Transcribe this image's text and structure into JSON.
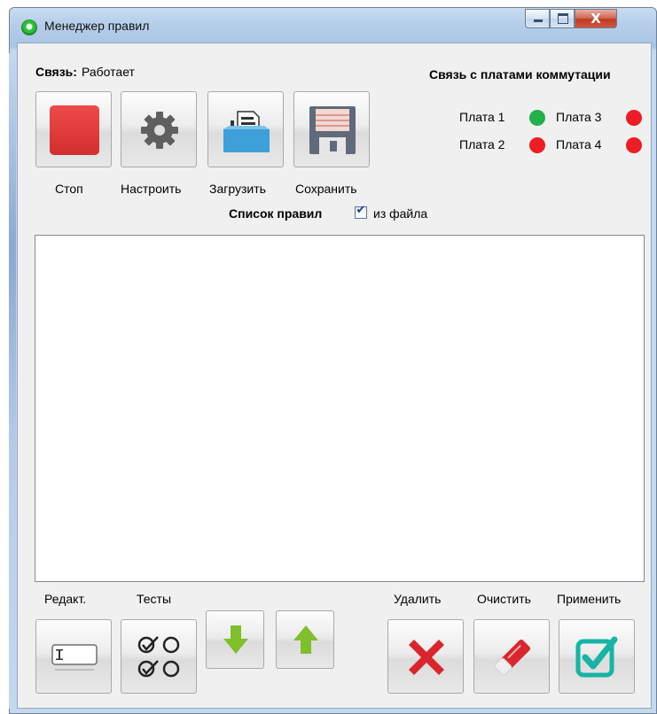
{
  "window": {
    "title": "Менеджер правил",
    "close_glyph": "X",
    "buttons": [
      "minimize-icon",
      "maximize-icon",
      "close-icon"
    ]
  },
  "status": {
    "label": "Связь:",
    "value": "Работает"
  },
  "boards": {
    "title": "Связь с платами коммутации",
    "items": [
      {
        "label": "Плата 1",
        "status": "ok",
        "color": "#22b04a"
      },
      {
        "label": "Плата 3",
        "status": "error",
        "color": "#ee1c24"
      },
      {
        "label": "Плата 2",
        "status": "error",
        "color": "#ee1c24"
      },
      {
        "label": "Плата 4",
        "status": "error",
        "color": "#ee1c24"
      }
    ]
  },
  "toolbar": {
    "stop": "Стоп",
    "configure": "Настроить",
    "load": "Загрузить",
    "save": "Сохранить"
  },
  "rules": {
    "title": "Список правил",
    "from_file_label": "из файла",
    "from_file_checked": true,
    "items": []
  },
  "bottom": {
    "edit": "Редакт.",
    "tests": "Тесты",
    "delete": "Удалить",
    "clear": "Очистить",
    "apply": "Применить",
    "move_down": "arrow-down-icon",
    "move_up": "arrow-up-icon"
  },
  "colors": {
    "stop": "#e0393a",
    "apply": "#17b3a4",
    "delete": "#d8262c",
    "arrow": "#7fbf2c"
  }
}
